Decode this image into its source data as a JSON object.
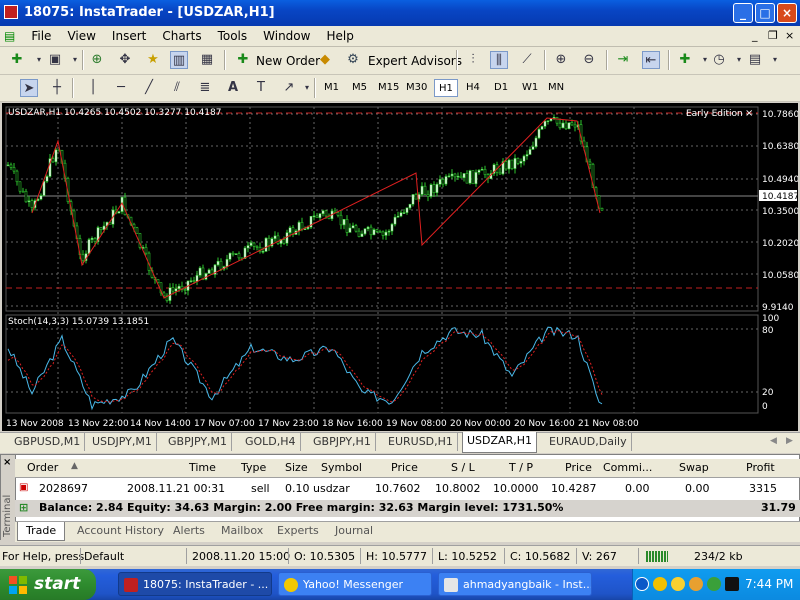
{
  "window": {
    "title": "18075: InstaTrader - [USDZAR,H1]"
  },
  "menu": [
    "File",
    "View",
    "Insert",
    "Charts",
    "Tools",
    "Window",
    "Help"
  ],
  "toolbar": {
    "new_order": "New Order",
    "expert_advisors": "Expert Advisors"
  },
  "timeframes": [
    "M1",
    "M5",
    "M15",
    "M30",
    "H1",
    "H4",
    "D1",
    "W1",
    "MN"
  ],
  "chart": {
    "info": "USDZAR,H1  10.4265 10.4502 10.3277 10.4187",
    "edition": "Early Edition",
    "price_labels": [
      "10.7860",
      "10.6380",
      "10.4940",
      "10.4187",
      "10.3500",
      "10.2020",
      "10.0580",
      "9.9140"
    ],
    "current_price": "10.4187",
    "stoch_label": "Stoch(14,3,3) 15.0739 13.1851",
    "stoch_levels": [
      "100",
      "80",
      "20",
      "0"
    ],
    "time_labels": [
      "13 Nov 2008",
      "13 Nov 22:00",
      "14 Nov 14:00",
      "17 Nov 07:00",
      "17 Nov 23:00",
      "18 Nov 16:00",
      "19 Nov 08:00",
      "20 Nov 00:00",
      "20 Nov 16:00",
      "21 Nov 08:00"
    ]
  },
  "chart_tabs": [
    "GBPUSD,M1",
    "USDJPY,M1",
    "GBPJPY,M1",
    "GOLD,H4",
    "GBPJPY,H1",
    "EURUSD,H1",
    "USDZAR,H1",
    "EURAUD,Daily"
  ],
  "terminal": {
    "side_label": "Terminal",
    "columns": [
      "Order",
      "Time",
      "Type",
      "Size",
      "Symbol",
      "Price",
      "S / L",
      "T / P",
      "Price",
      "Commi...",
      "Swap",
      "Profit"
    ],
    "order": {
      "order": "2028697",
      "time": "2008.11.21 00:31",
      "type": "sell",
      "size": "0.10",
      "symbol": "usdzar",
      "price": "10.7602",
      "sl": "10.8002",
      "tp": "10.0000",
      "cur_price": "10.4287",
      "commission": "0.00",
      "swap": "0.00",
      "profit": "3315"
    },
    "balance_line": "Balance: 2.84  Equity: 34.63  Margin: 2.00  Free margin: 32.63  Margin level: 1731.50%",
    "balance_total": "31.79",
    "tabs": [
      "Trade",
      "Account History",
      "Alerts",
      "Mailbox",
      "Experts",
      "Journal"
    ]
  },
  "status": {
    "help": "For Help, press",
    "profile": "Default",
    "time": "2008.11.20 15:00",
    "open": "O: 10.5305",
    "high": "H: 10.5777",
    "low": "L: 10.5252",
    "close": "C: 10.5682",
    "volume": "V: 267",
    "traffic": "234/2 kb"
  },
  "taskbar": {
    "start": "start",
    "items": [
      "18075: InstaTrader - ...",
      "Yahoo! Messenger",
      "ahmadyangbaik - Inst..."
    ],
    "clock": "7:44 PM"
  }
}
